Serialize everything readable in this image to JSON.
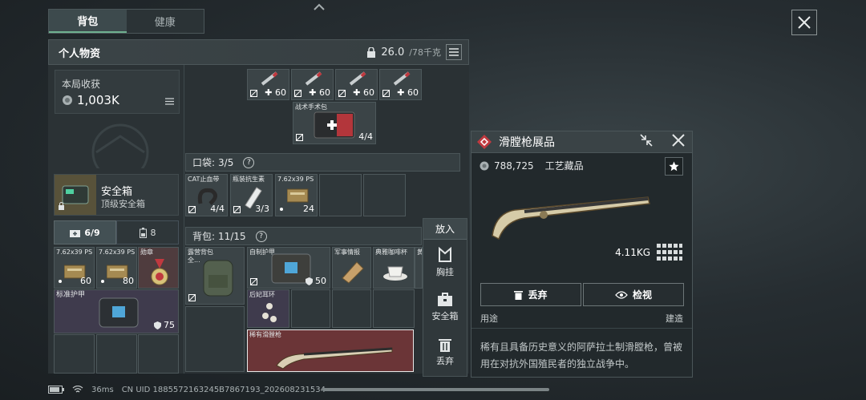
{
  "tabs": [
    {
      "label": "背包",
      "active": true
    },
    {
      "label": "健康",
      "active": false
    }
  ],
  "header": {
    "title": "个人物资",
    "weight_value": "26.0",
    "weight_max": "/78千克"
  },
  "earnings": {
    "label": "本局收获",
    "value": "1,003K"
  },
  "safe_box": {
    "title": "安全箱",
    "subtitle": "顶级安全箱"
  },
  "left_tabs": [
    {
      "label": "6/9",
      "icon": "first-aid-icon"
    },
    {
      "label": "8",
      "icon": "battery-icon"
    }
  ],
  "left_items": {
    "ammo1_label": "7.62x39 PS",
    "ammo1_count": "60",
    "ammo2_label": "7.62x39 PS",
    "ammo2_count": "80",
    "medal_label": "勋章",
    "armor_label": "标准护甲",
    "armor_value": "75"
  },
  "top_items": {
    "syringe_count": "60",
    "medkit_label": "战术手术包",
    "medkit_count": "4/4"
  },
  "pocket": {
    "label": "口袋:",
    "count": "3/5",
    "items": [
      {
        "label": "CAT止血带",
        "count": "4/4"
      },
      {
        "label": "瓶装抗生素",
        "count": "3/3"
      },
      {
        "label": "7.62x39 PS",
        "count": "24"
      }
    ]
  },
  "backpack": {
    "label": "背包:",
    "count": "11/15",
    "bag_label": "露营背包 全...",
    "armor_label": "自制护甲",
    "armor_value": "50",
    "intel_label": "军事情报",
    "coffee_label": "典雅咖啡杯",
    "extra_label": "黄",
    "earring_label": "后妃耳环",
    "rifle_label": "稀有滑膛枪"
  },
  "side_actions": {
    "put": "放入",
    "chest": "胸挂",
    "safe": "安全箱",
    "discard": "丢弃"
  },
  "detail": {
    "title": "滑膛枪展品",
    "price": "788,725",
    "category": "工艺藏品",
    "weight": "4.11KG",
    "discard": "丢弃",
    "inspect": "检视",
    "use_label": "用途",
    "use_value": "建造",
    "description": "稀有且具备历史意义的阿萨拉土制滑膛枪，曾被用在对抗外国殖民者的独立战争中。"
  },
  "status": {
    "ping": "36ms",
    "uid": "CN UID 1885572163245B7867193_202608231534"
  },
  "colors": {
    "accent_green": "#6fb08f",
    "rare_red": "#c0393f",
    "highlight_rifle": "#6b3537"
  }
}
